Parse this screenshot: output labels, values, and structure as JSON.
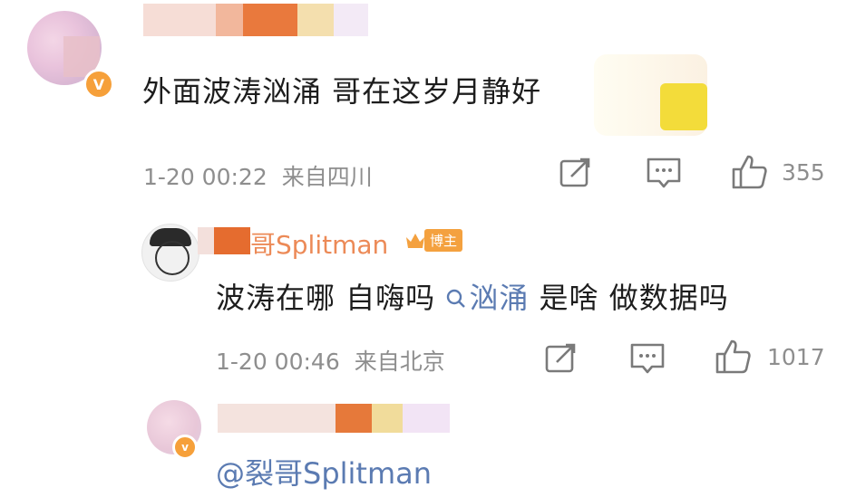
{
  "comments": [
    {
      "text": "外面波涛汹涌 哥在这岁月静好",
      "timestamp": "1-20 00:22",
      "location": "来自四川",
      "like_count": "355",
      "verified_badge": "V"
    },
    {
      "author_visible": "哥Splitman",
      "badge_label": "博主",
      "text_before": "波涛在哪 自嗨吗 ",
      "topic_link": "汹涌",
      "text_after": " 是啥 做数据吗",
      "timestamp": "1-20 00:46",
      "location": "来自北京",
      "like_count": "1017"
    },
    {
      "mention": "@裂哥Splitman",
      "verified_badge": "v"
    }
  ],
  "icons": {
    "share": "share-icon",
    "comment": "comment-icon",
    "like": "thumbs-up-icon",
    "search": "search-icon"
  },
  "colors": {
    "link": "#5b7bb2",
    "meta": "#8e8e8e",
    "badge": "#f4a13f"
  }
}
